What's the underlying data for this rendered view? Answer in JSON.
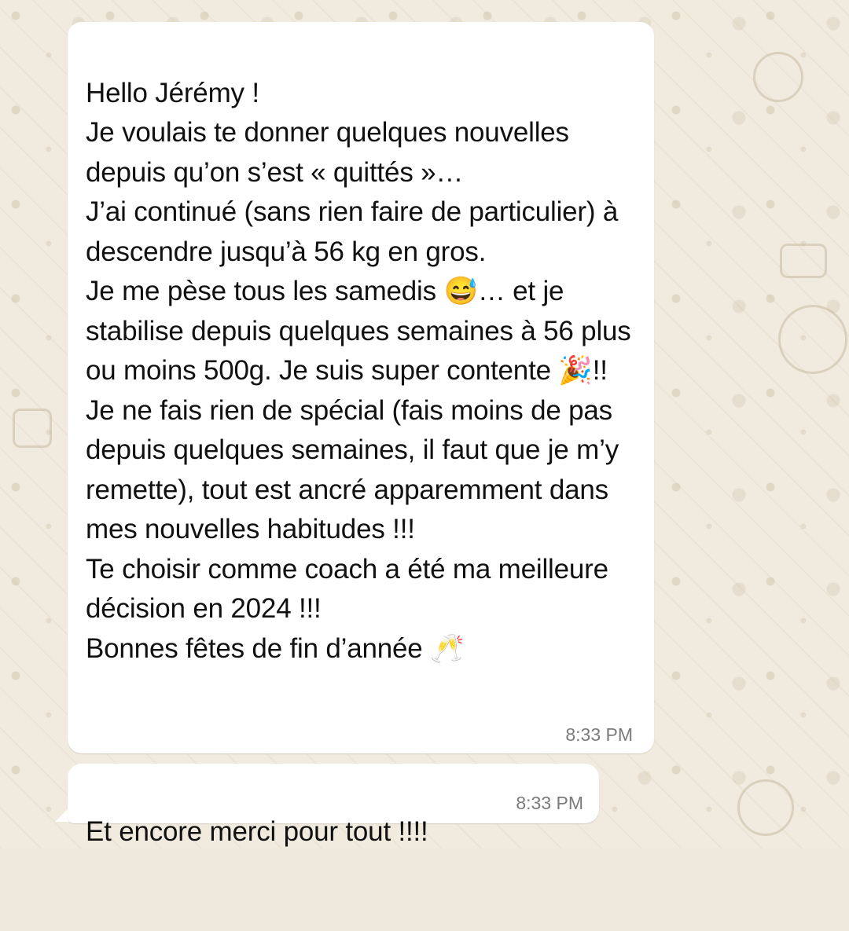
{
  "chat": {
    "messages": [
      {
        "text": "Hello Jérémy !\nJe voulais te donner quelques nouvelles depuis qu’on s’est « quittés »…\nJ’ai continué (sans rien faire de particulier) à descendre jusqu’à 56 kg en gros.\nJe me pèse tous les samedis 😅… et je stabilise depuis quelques semaines à 56 plus ou moins 500g. Je suis super contente 🎉!!\nJe ne fais rien de spécial (fais moins de pas depuis quelques semaines, il faut que je m’y remette), tout est ancré apparemment dans mes nouvelles habitudes !!!\nTe choisir comme coach a été ma meilleure décision en 2024 !!!\nBonnes fêtes de fin d’année 🥂",
        "time": "8:33 PM"
      },
      {
        "text": "Et encore merci pour tout !!!!",
        "time": "8:33 PM"
      }
    ]
  },
  "colors": {
    "wallpaper": "#f1ebdf",
    "bubble": "#ffffff",
    "text": "#111111",
    "timestamp": "#7b7b7b"
  }
}
